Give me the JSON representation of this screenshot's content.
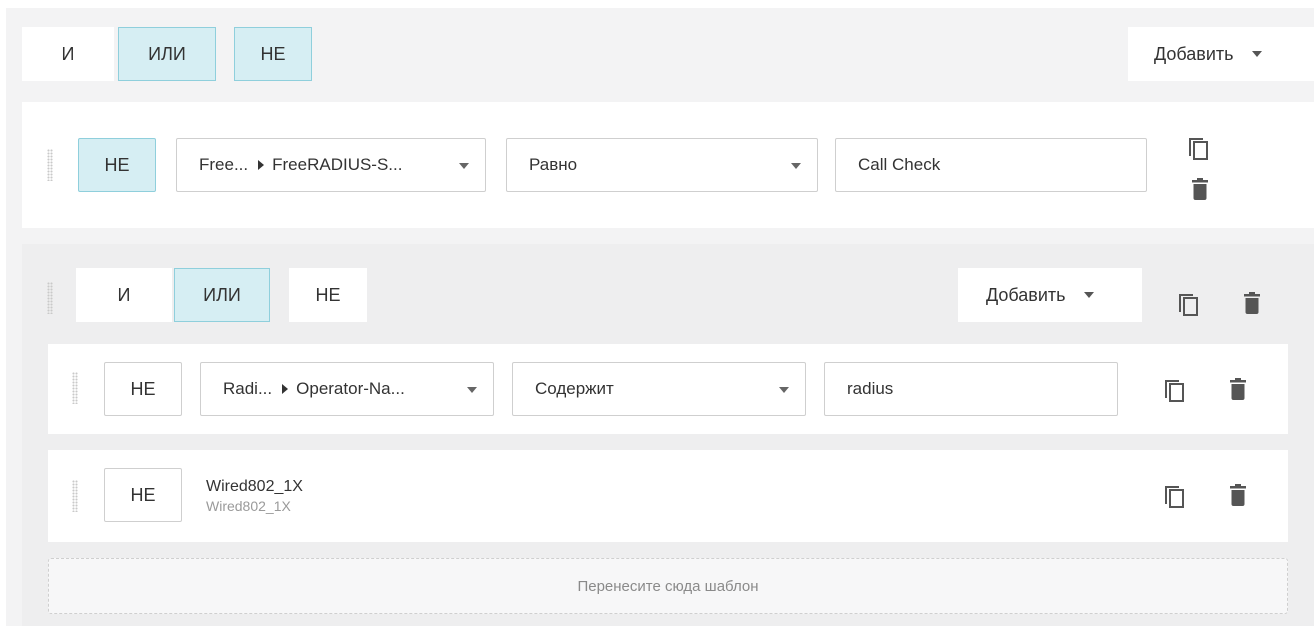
{
  "top": {
    "segments": [
      "И",
      "ИЛИ",
      "НЕ"
    ],
    "active": [
      "ИЛИ",
      "НЕ"
    ],
    "add_label": "Добавить"
  },
  "rule1": {
    "not_label": "НЕ",
    "attribute": {
      "vendor": "Free...",
      "name": "FreeRADIUS-S..."
    },
    "operator": "Равно",
    "value": "Call Check"
  },
  "group": {
    "segments": [
      "И",
      "ИЛИ",
      "НЕ"
    ],
    "active": [
      "ИЛИ"
    ],
    "add_label": "Добавить",
    "rule": {
      "not_label": "НЕ",
      "attribute": {
        "vendor": "Radi...",
        "name": "Operator-Na..."
      },
      "operator": "Содержит",
      "value": "radius"
    },
    "template": {
      "not_label": "НЕ",
      "title": "Wired802_1X",
      "subtitle": "Wired802_1X"
    },
    "drop_zone": "Перенесите сюда шаблон"
  },
  "icons": {
    "copy": "copy-icon",
    "delete": "trash-icon",
    "drag": "drag-handle-icon"
  }
}
